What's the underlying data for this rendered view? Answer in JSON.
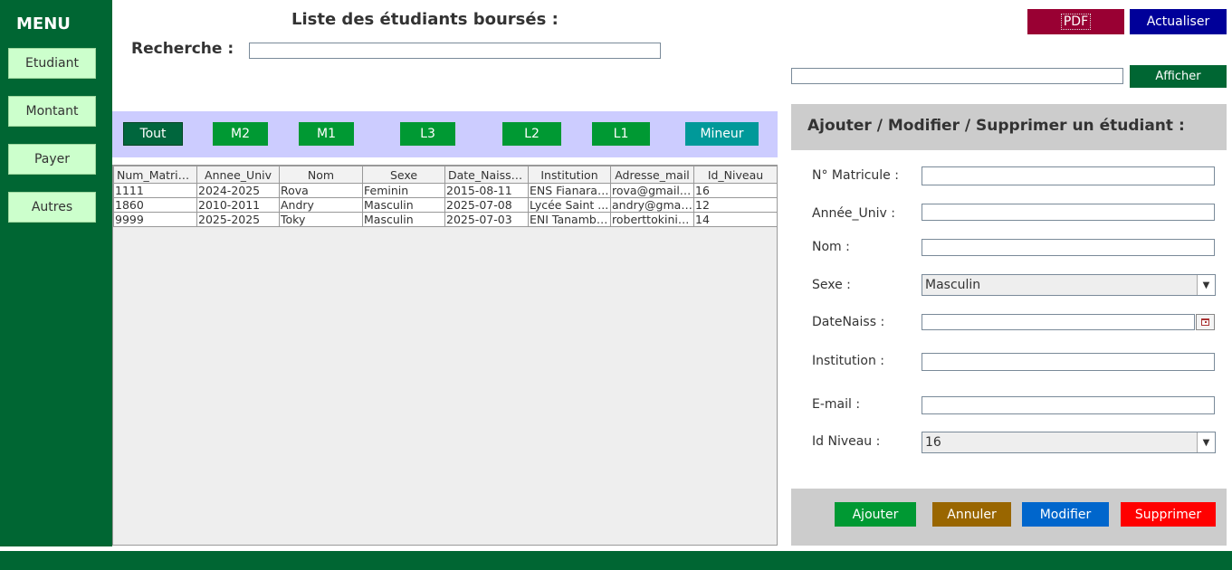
{
  "sidebar": {
    "title": "MENU",
    "items": [
      {
        "label": "Etudiant"
      },
      {
        "label": "Montant"
      },
      {
        "label": "Payer"
      },
      {
        "label": "Autres"
      }
    ]
  },
  "header": {
    "title": "Liste des étudiants boursés :",
    "search_label": "Recherche :",
    "search_value": "",
    "pdf_label": "PDF",
    "refresh_label": "Actualiser",
    "afficher_value": "",
    "afficher_label": "Afficher"
  },
  "filters": [
    {
      "label": "Tout",
      "color": "#00663d"
    },
    {
      "label": "M2",
      "color": "#009933"
    },
    {
      "label": "M1",
      "color": "#009933"
    },
    {
      "label": "L3",
      "color": "#009933"
    },
    {
      "label": "L2",
      "color": "#009933"
    },
    {
      "label": "L1",
      "color": "#009933"
    },
    {
      "label": "Mineur",
      "color": "#009999"
    }
  ],
  "table": {
    "columns": [
      "Num_Matricule",
      "Annee_Univ",
      "Nom",
      "Sexe",
      "Date_Naissance",
      "Institution",
      "Adresse_mail",
      "Id_Niveau"
    ],
    "rows": [
      [
        "1111",
        "2024-2025",
        "Rova",
        "Feminin",
        "2015-08-11",
        "ENS Fianarantsoa",
        "rova@gmail.com",
        "16"
      ],
      [
        "1860",
        "2010-2011",
        "Andry",
        "Masculin",
        "2025-07-08",
        "Lycée Saint ...",
        "andry@gmail.com",
        "12"
      ],
      [
        "9999",
        "2025-2025",
        "Toky",
        "Masculin",
        "2025-07-03",
        "ENI Tanambao",
        "roberttokiniaina@gmail.com",
        "14"
      ]
    ]
  },
  "form": {
    "title": "Ajouter / Modifier / Supprimer un étudiant :",
    "fields": {
      "matricule": {
        "label": "N° Matricule :",
        "value": ""
      },
      "annee": {
        "label": "Année_Univ :",
        "value": ""
      },
      "nom": {
        "label": "Nom :",
        "value": ""
      },
      "sexe": {
        "label": "Sexe :",
        "value": "Masculin"
      },
      "datenaiss": {
        "label": "DateNaiss :",
        "value": ""
      },
      "institution": {
        "label": "Institution :",
        "value": ""
      },
      "email": {
        "label": "E-mail :",
        "value": ""
      },
      "niveau": {
        "label": "Id Niveau :",
        "value": "16"
      }
    },
    "actions": {
      "ajouter": {
        "label": "Ajouter",
        "color": "#009933"
      },
      "annuler": {
        "label": "Annuler",
        "color": "#996600"
      },
      "modifier": {
        "label": "Modifier",
        "color": "#0066cc"
      },
      "supprimer": {
        "label": "Supprimer",
        "color": "#ff0000"
      }
    }
  },
  "colors": {
    "sidebar": "#006633",
    "pdf": "#990033",
    "refresh": "#000099",
    "filter_bar": "#ccccff"
  }
}
